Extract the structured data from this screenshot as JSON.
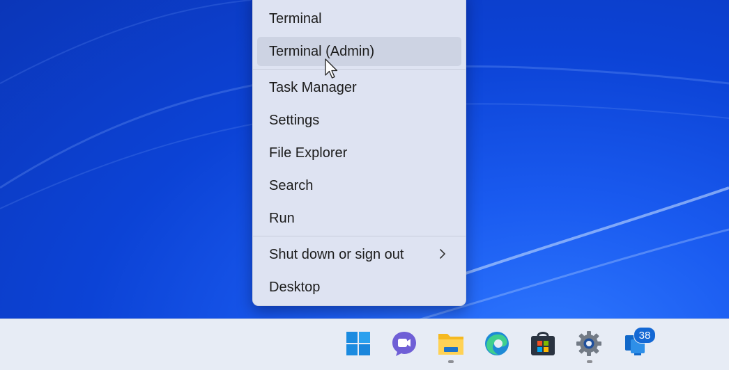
{
  "menu": {
    "items": [
      {
        "label": "Terminal"
      },
      {
        "label": "Terminal (Admin)"
      },
      {
        "label": "Task Manager"
      },
      {
        "label": "Settings"
      },
      {
        "label": "File Explorer"
      },
      {
        "label": "Search"
      },
      {
        "label": "Run"
      },
      {
        "label": "Shut down or sign out"
      },
      {
        "label": "Desktop"
      }
    ],
    "hovered_item": "Terminal (Admin)",
    "submenu_icon": "chevron-right-icon"
  },
  "taskbar": {
    "icons": [
      {
        "name": "start-icon"
      },
      {
        "name": "teams-chat-icon"
      },
      {
        "name": "file-explorer-icon"
      },
      {
        "name": "edge-icon"
      },
      {
        "name": "microsoft-store-icon"
      },
      {
        "name": "settings-icon"
      },
      {
        "name": "remote-desktop-icon"
      }
    ],
    "notification_badge": "38"
  },
  "colors": {
    "wallpaper": "#1a5bf0",
    "menu_bg": "#dee3f2",
    "hover_bg": "#cdd3e3",
    "taskbar_bg": "#e7ecf5",
    "accent": "#1468d4"
  }
}
